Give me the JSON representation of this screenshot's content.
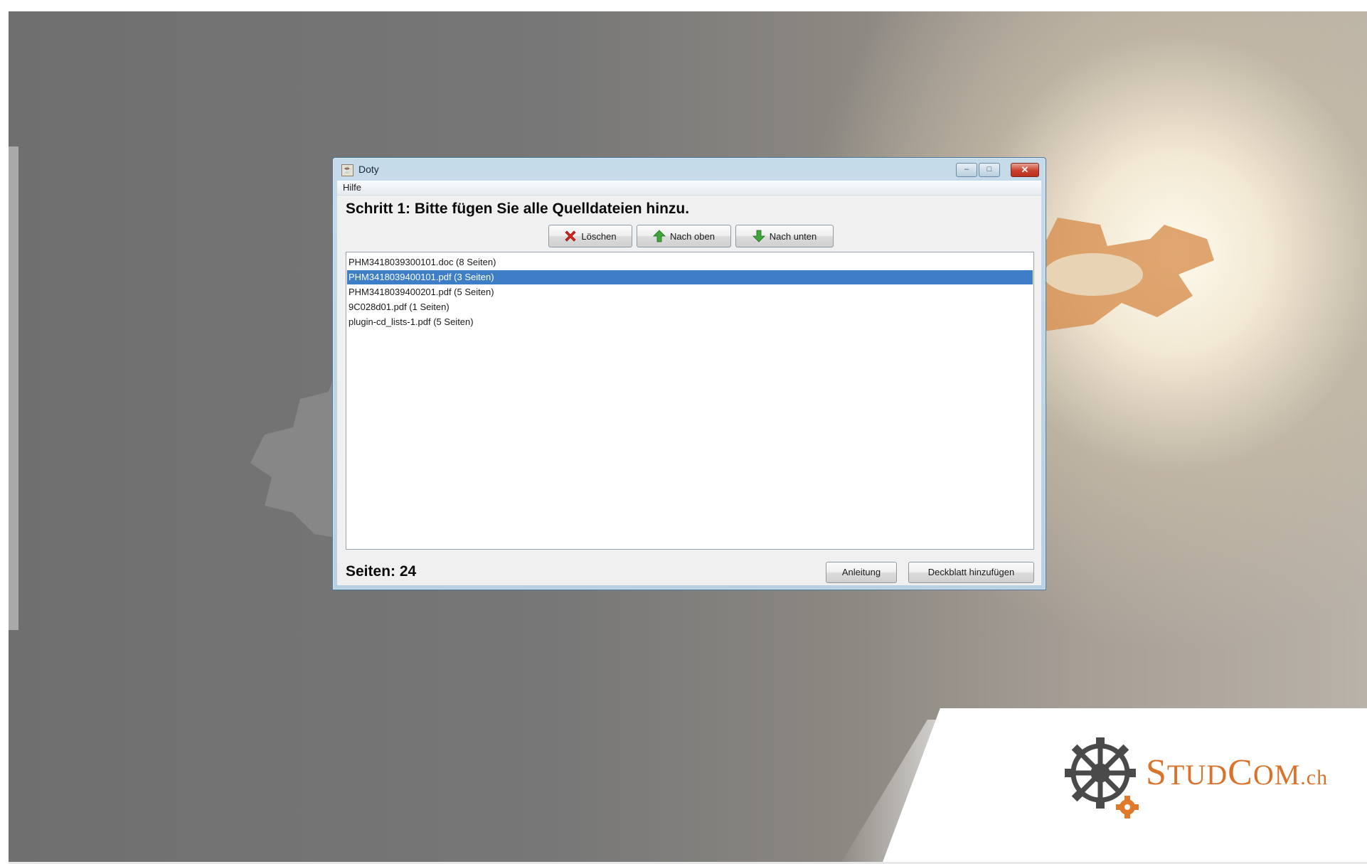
{
  "window": {
    "title": "Doty",
    "controls": {
      "minimize": "–",
      "maximize": "□",
      "close": "✕"
    }
  },
  "menu": {
    "items": [
      {
        "label": "Hilfe"
      }
    ]
  },
  "heading": "Schritt 1: Bitte fügen Sie alle Quelldateien hinzu.",
  "toolbar": {
    "delete_label": "Löschen",
    "up_label": "Nach oben",
    "down_label": "Nach unten"
  },
  "files": [
    {
      "label": "PHM3418039300101.doc (8 Seiten)",
      "selected": false
    },
    {
      "label": "PHM3418039400101.pdf (3 Seiten)",
      "selected": true
    },
    {
      "label": "PHM3418039400201.pdf (5 Seiten)",
      "selected": false
    },
    {
      "label": "9C028d01.pdf (1 Seiten)",
      "selected": false
    },
    {
      "label": "plugin-cd_lists-1.pdf (5 Seiten)",
      "selected": false
    }
  ],
  "footer": {
    "pages_label": "Seiten: 24",
    "guide_label": "Anleitung",
    "cover_label": "Deckblatt hinzufügen"
  },
  "brand": {
    "part1": "S",
    "part2": "TUD",
    "part3": "C",
    "part4": "OM",
    "part5": ".ch"
  },
  "icons": {
    "delete": "red-x-icon",
    "up": "green-arrow-up-icon",
    "down": "green-arrow-down-icon",
    "app": "java-cup-icon"
  },
  "colors": {
    "selection": "#3d7ec6",
    "brand_orange": "#d9732b",
    "titlebar": "#c6dbea"
  }
}
